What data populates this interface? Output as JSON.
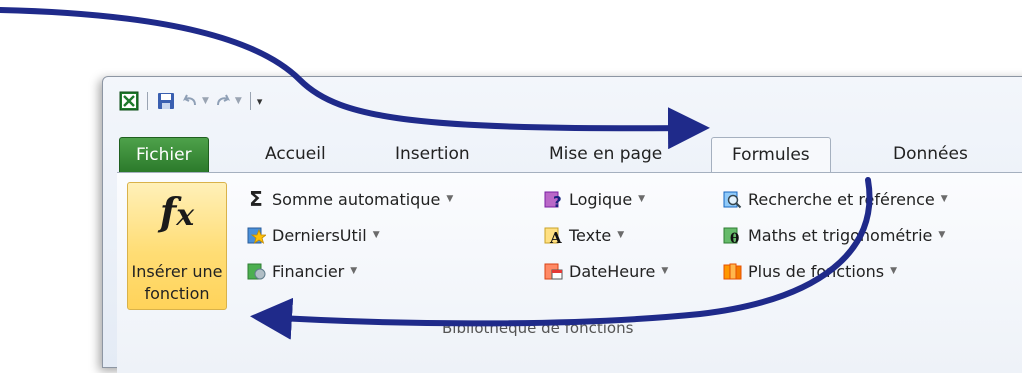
{
  "tabs": {
    "file": "Fichier",
    "home": "Accueil",
    "insert": "Insertion",
    "layout": "Mise en page",
    "formulas": "Formules",
    "data": "Données"
  },
  "ribbon": {
    "insert_function": {
      "icon": "fx-icon",
      "line1": "Insérer une",
      "line2": "fonction"
    },
    "commands": {
      "autosum": "Somme automatique",
      "recent": "DerniersUtil",
      "financial": "Financier",
      "logical": "Logique",
      "text": "Texte",
      "datetime": "DateHeure",
      "lookup": "Recherche et référence",
      "math": "Maths et trigonométrie",
      "more": "Plus de fonctions"
    },
    "group_label": "Bibliothèque de fonctions"
  },
  "qat": {
    "icons": [
      "excel-icon",
      "save-icon",
      "undo-icon",
      "redo-icon",
      "customize-icon"
    ]
  },
  "colors": {
    "file_tab": "#2e7d32",
    "arrow": "#1a237e",
    "insert_fn_bg": "#ffdd75"
  }
}
